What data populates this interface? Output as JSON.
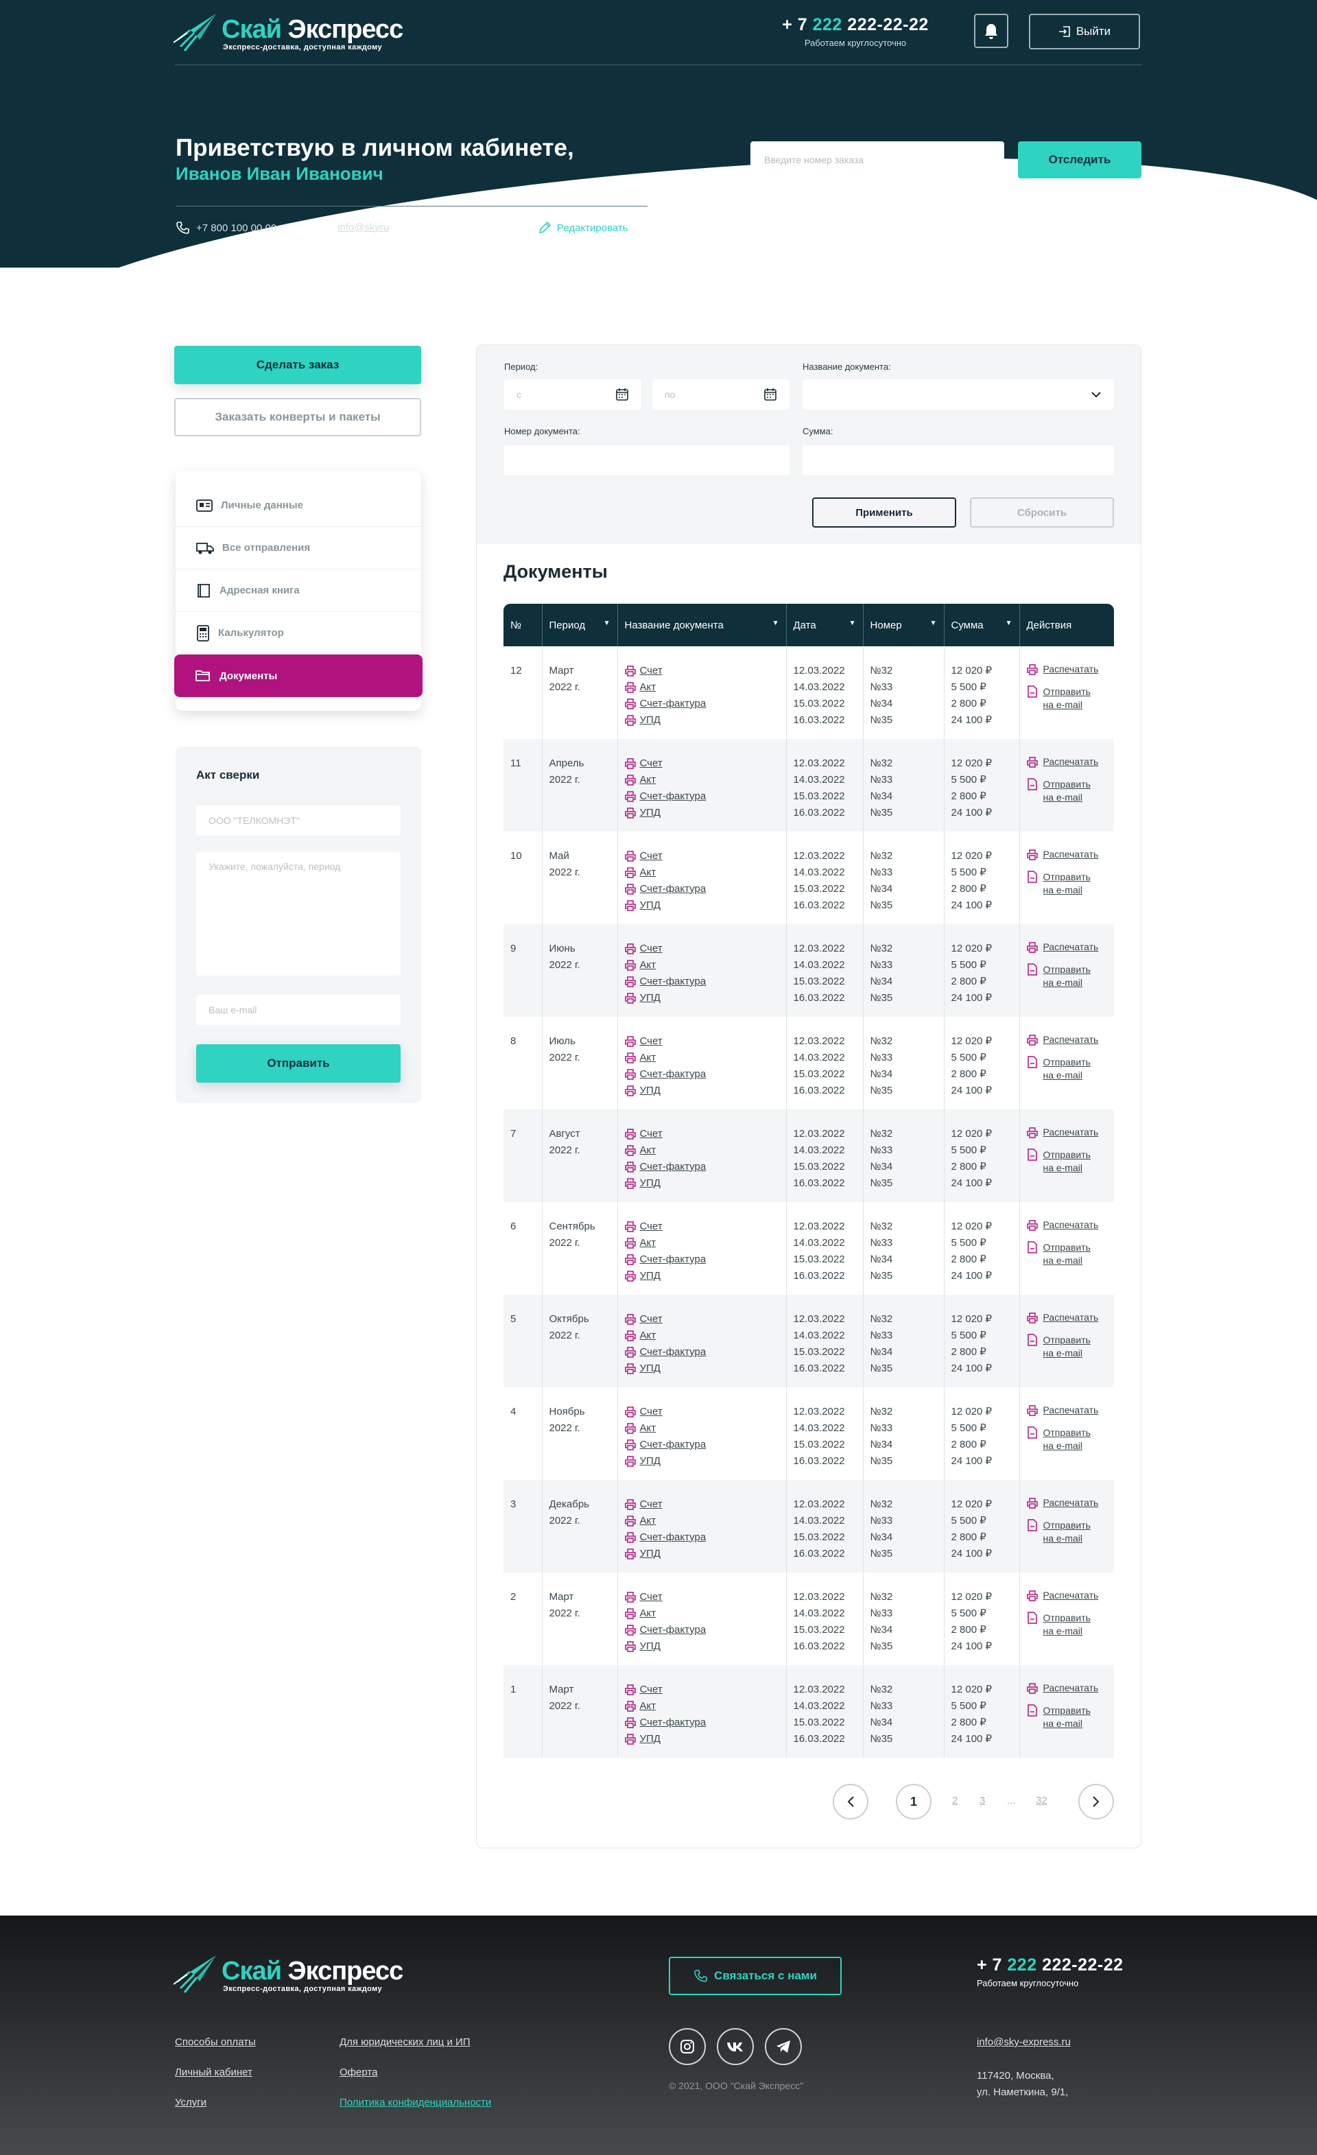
{
  "brand": {
    "name_part1": "Скай",
    "name_part2": "Экспресс",
    "tagline": "Экспресс-доставка, доступная каждому"
  },
  "header": {
    "phone_prefix": "+ 7",
    "phone_code": "222",
    "phone_number": "222-22-22",
    "phone_note": "Работаем круглосуточно",
    "logout_label": "Выйти"
  },
  "greeting": {
    "line1": "Приветствую в личном кабинете,",
    "name": "Иванов Иван Иванович",
    "phone": "+7 800 100 00 00",
    "email": "info@skyru",
    "edit_label": "Редактировать"
  },
  "track": {
    "placeholder": "Введите номер заказа",
    "button": "Отследить"
  },
  "sidebar": {
    "order_button": "Сделать заказ",
    "envelopes_button": "Заказать конверты и пакеты",
    "menu": [
      {
        "label": "Личные данные",
        "icon": "id-card-icon"
      },
      {
        "label": "Все отправления",
        "icon": "truck-icon"
      },
      {
        "label": "Адресная книга",
        "icon": "book-icon"
      },
      {
        "label": "Калькулятор",
        "icon": "calculator-icon"
      },
      {
        "label": "Документы",
        "icon": "folder-icon",
        "active": true
      }
    ]
  },
  "reconciliation": {
    "title": "Акт сверки",
    "company_placeholder": "ООО \"ТЕЛКОМНЭТ\"",
    "period_placeholder": "Укажите, пожалуйста, период",
    "email_placeholder": "Ваш e-mail",
    "submit": "Отправить"
  },
  "filters": {
    "period_label": "Период:",
    "from_placeholder": "с",
    "to_placeholder": "по",
    "docname_label": "Название документа:",
    "docnum_label": "Номер документа:",
    "sum_label": "Сумма:",
    "apply": "Применить",
    "reset": "Сбросить"
  },
  "documents": {
    "title": "Документы",
    "columns": [
      "№",
      "Период",
      "Название документа",
      "Дата",
      "Номер",
      "Сумма",
      "Действия"
    ],
    "doc_types": [
      "Счет",
      "Акт",
      "Счет-фактура",
      "УПД"
    ],
    "dates": [
      "12.03.2022",
      "14.03.2022",
      "15.03.2022",
      "16.03.2022"
    ],
    "numbers": [
      "№32",
      "№33",
      "№34",
      "№35"
    ],
    "sums": [
      "12 020 ₽",
      "5 500 ₽",
      "2 800 ₽",
      "24 100 ₽"
    ],
    "action_print": "Распечатать",
    "action_send_1": "Отправить",
    "action_send_2": "на e-mail",
    "rows": [
      {
        "n": "12",
        "month": "Март",
        "year": "2022 г."
      },
      {
        "n": "11",
        "month": "Апрель",
        "year": "2022 г."
      },
      {
        "n": "10",
        "month": "Май",
        "year": "2022 г."
      },
      {
        "n": "9",
        "month": "Июнь",
        "year": "2022 г."
      },
      {
        "n": "8",
        "month": "Июль",
        "year": "2022 г."
      },
      {
        "n": "7",
        "month": "Август",
        "year": "2022 г."
      },
      {
        "n": "6",
        "month": "Сентябрь",
        "year": "2022 г."
      },
      {
        "n": "5",
        "month": "Октябрь",
        "year": "2022 г."
      },
      {
        "n": "4",
        "month": "Ноябрь",
        "year": "2022 г."
      },
      {
        "n": "3",
        "month": "Декабрь",
        "year": "2022 г."
      },
      {
        "n": "2",
        "month": "Март",
        "year": "2022 г."
      },
      {
        "n": "1",
        "month": "Март",
        "year": "2022 г."
      }
    ]
  },
  "pagination": {
    "current": "1",
    "pages": [
      "2",
      "3",
      "...",
      "32"
    ]
  },
  "footer": {
    "contact_button": "Связаться с нами",
    "links_col1": [
      "Способы оплаты",
      "Личный кабинет",
      "Услуги"
    ],
    "links_col2": [
      "Для юридических лиц и ИП",
      "Оферта",
      "Политика конфиденциальности"
    ],
    "copyright": "© 2021, ООО \"Скай Экспресс\"",
    "email": "info@sky-express.ru",
    "address_1": "117420, Москва,",
    "address_2": "ул. Наметкина, 9/1,",
    "social": [
      {
        "icon": "instagram-icon"
      },
      {
        "icon": "vk-icon"
      },
      {
        "icon": "telegram-icon"
      }
    ]
  },
  "colors": {
    "dark": "#0f2f3a",
    "teal": "#2ed3c1",
    "magenta": "#b0127e"
  }
}
